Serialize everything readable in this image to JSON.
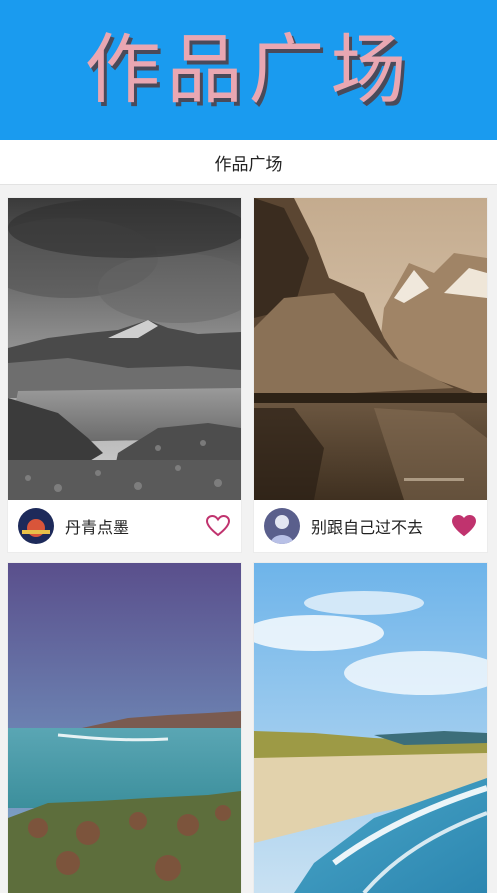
{
  "banner": {
    "title": "作品广场"
  },
  "header": {
    "title": "作品广场"
  },
  "cards": [
    {
      "author": "丹青点墨",
      "liked": false
    },
    {
      "author": "别跟自己过不去",
      "liked": true
    },
    {
      "author": "",
      "liked": false
    },
    {
      "author": "",
      "liked": false
    }
  ],
  "colors": {
    "banner": "#1a9bef",
    "banner_text": "#e9a7b2",
    "heart": "#c0336e"
  }
}
